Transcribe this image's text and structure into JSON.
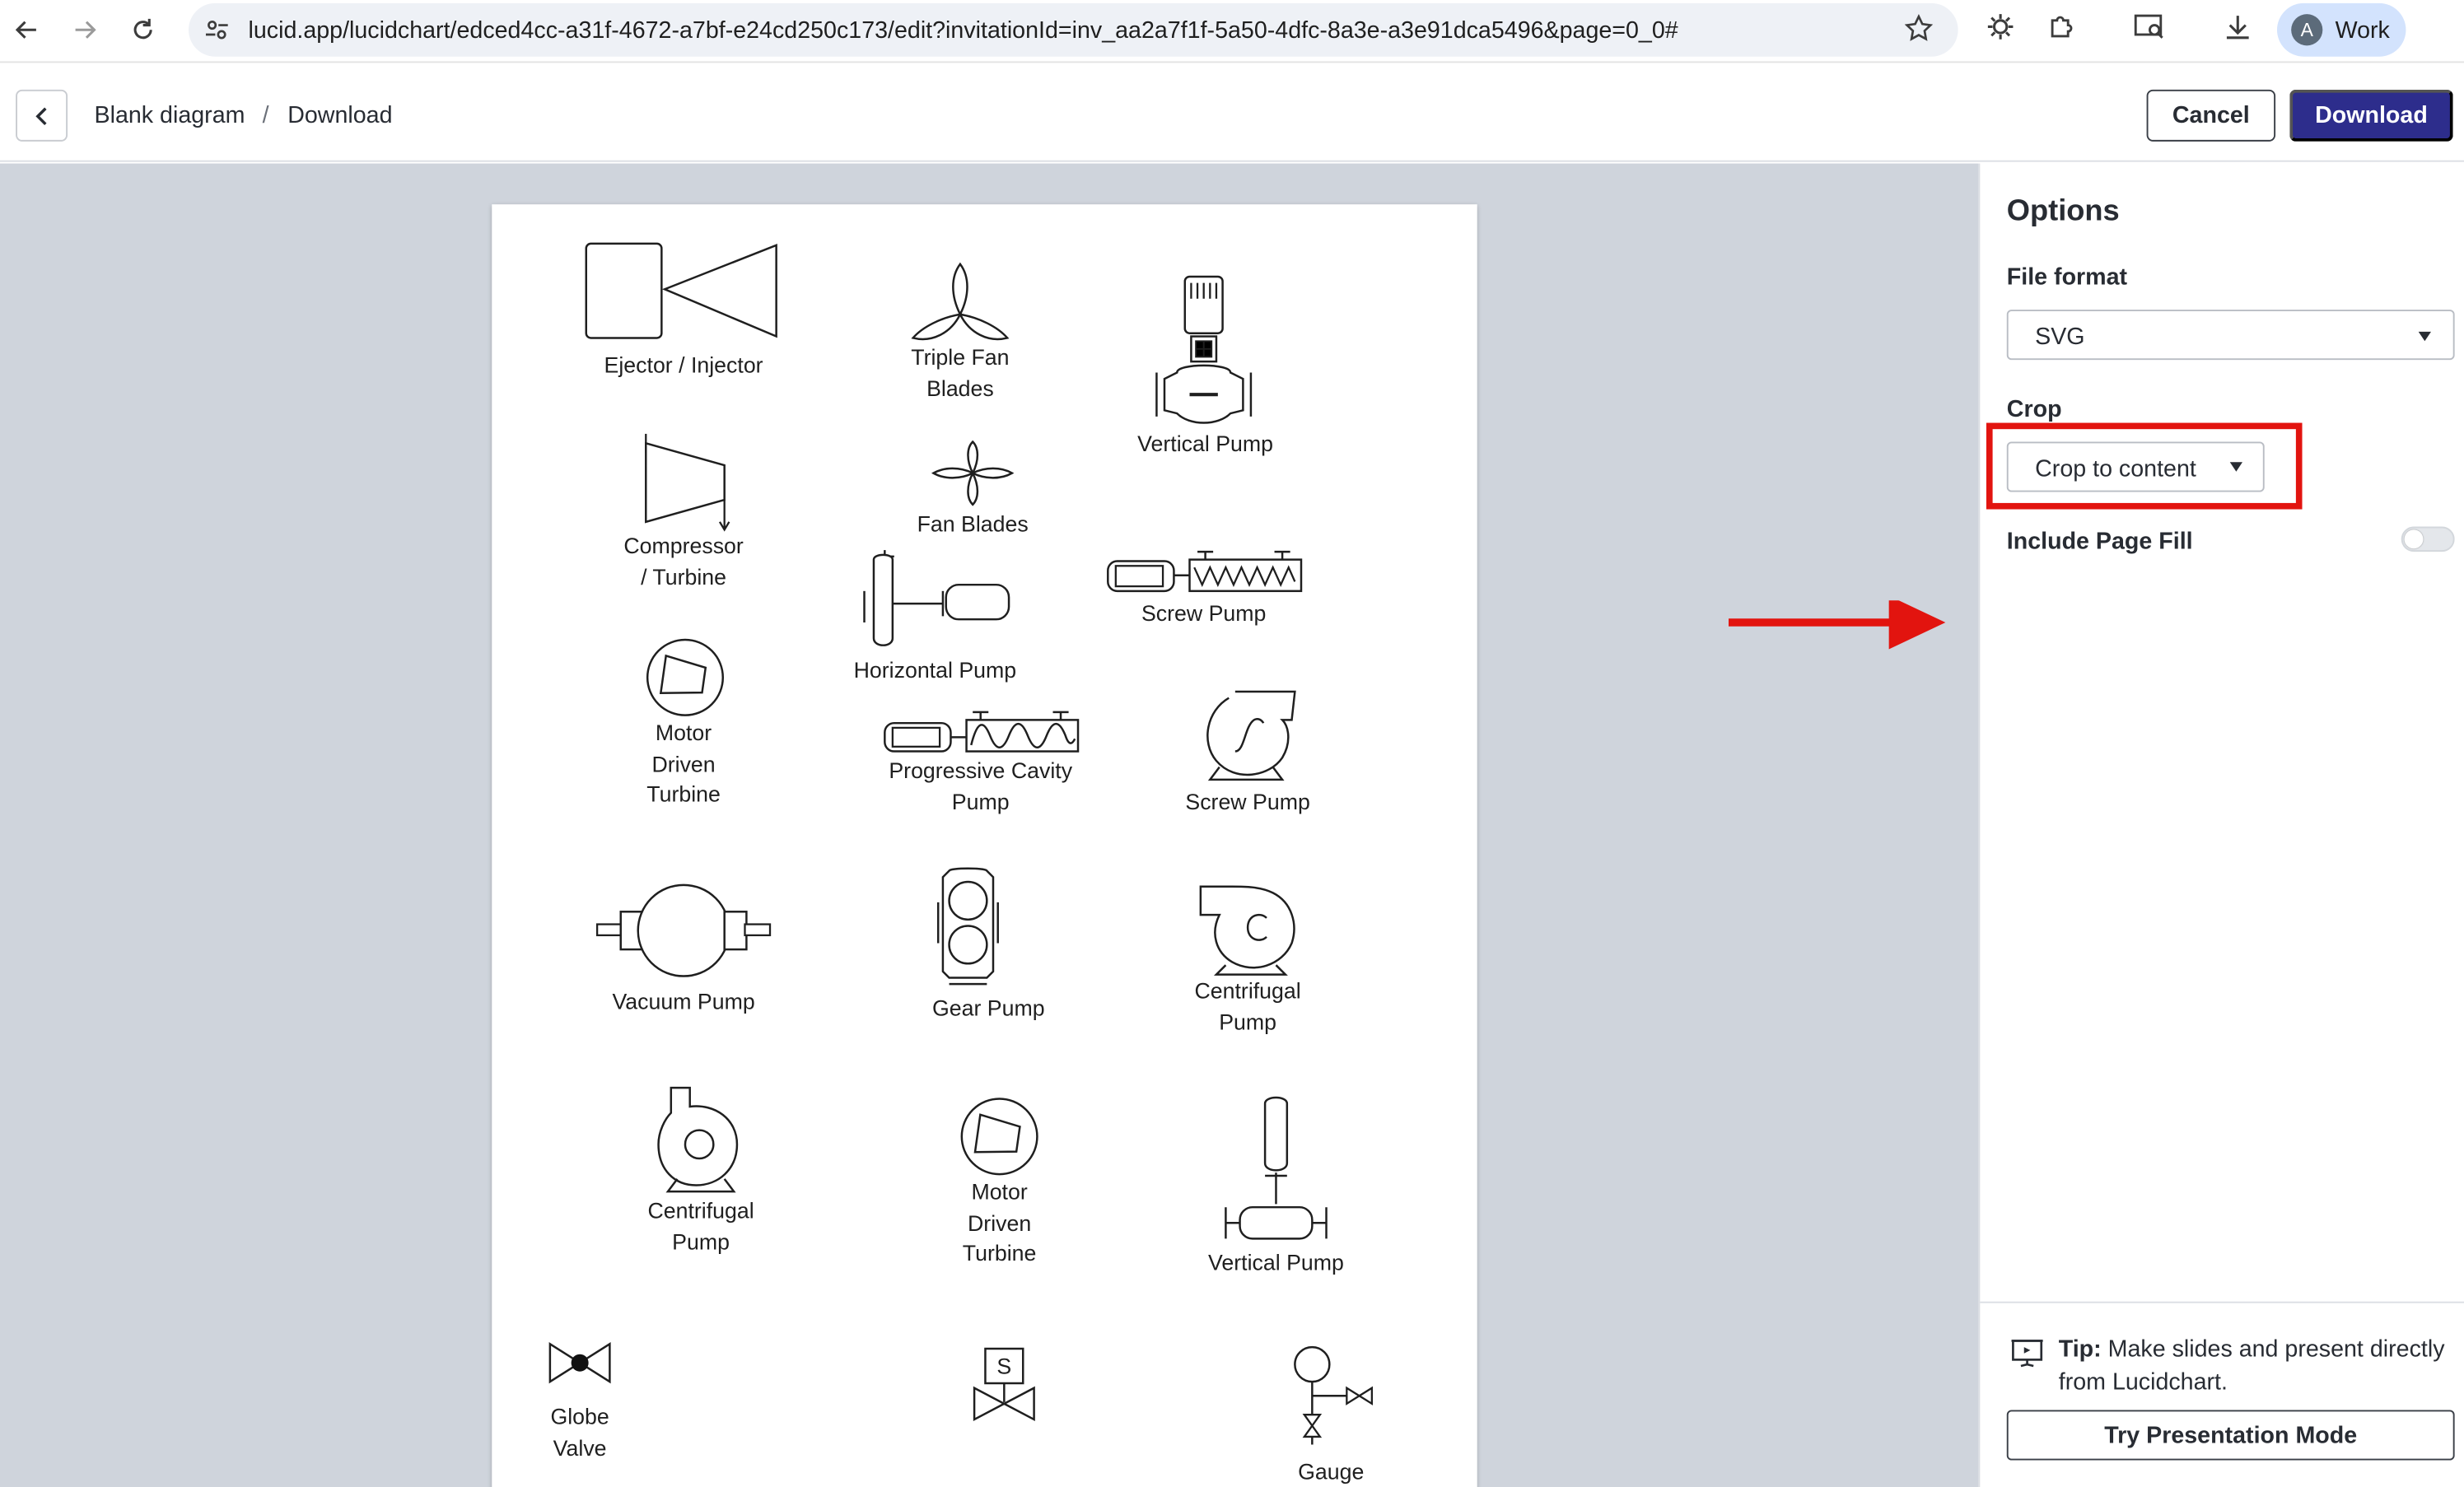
{
  "browser": {
    "url": "lucid.app/lucidchart/edced4cc-a31f-4672-a7bf-e24cd250c173/edit?invitationId=inv_aa2a7f1f-5a50-4dfc-8a3e-a3e91dca5496&page=0_0#",
    "profile_initial": "A",
    "profile_label": "Work"
  },
  "header": {
    "breadcrumb_doc": "Blank diagram",
    "breadcrumb_sep": "/",
    "breadcrumb_page": "Download",
    "cancel_label": "Cancel",
    "download_label": "Download"
  },
  "canvas": {
    "shapes": [
      {
        "id": "ejector-injector",
        "label": "Ejector / Injector"
      },
      {
        "id": "triple-fan-blades",
        "label": "Triple Fan\nBlades"
      },
      {
        "id": "vertical-pump-1",
        "label": "Vertical Pump"
      },
      {
        "id": "compressor-turbine",
        "label": "Compressor\n/ Turbine"
      },
      {
        "id": "fan-blades",
        "label": "Fan Blades"
      },
      {
        "id": "horizontal-pump",
        "label": "Horizontal Pump"
      },
      {
        "id": "screw-pump-1",
        "label": "Screw Pump"
      },
      {
        "id": "motor-driven-turbine-1",
        "label": "Motor\nDriven\nTurbine"
      },
      {
        "id": "progressive-cavity-pump",
        "label": "Progressive Cavity\nPump"
      },
      {
        "id": "screw-pump-2",
        "label": "Screw Pump"
      },
      {
        "id": "vacuum-pump",
        "label": "Vacuum Pump"
      },
      {
        "id": "gear-pump",
        "label": "Gear Pump"
      },
      {
        "id": "centrifugal-pump-1",
        "label": "Centrifugal\nPump"
      },
      {
        "id": "centrifugal-pump-2",
        "label": "Centrifugal\nPump"
      },
      {
        "id": "motor-driven-turbine-2",
        "label": "Motor\nDriven\nTurbine"
      },
      {
        "id": "vertical-pump-2",
        "label": "Vertical Pump"
      },
      {
        "id": "globe-valve",
        "label": "Globe\nValve"
      },
      {
        "id": "solenoid-valve-letter",
        "label": "S"
      },
      {
        "id": "gauge",
        "label": "Gauge"
      }
    ]
  },
  "options": {
    "title": "Options",
    "file_format_label": "File format",
    "file_format_value": "SVG",
    "crop_label": "Crop",
    "crop_value": "Crop to content",
    "include_page_fill_label": "Include Page Fill",
    "include_page_fill_on": false,
    "tip_bold": "Tip:",
    "tip_text": " Make slides and present directly from Lucidchart.",
    "try_button_label": "Try Presentation Mode"
  },
  "colors": {
    "primary_button": "#2d2d8c",
    "annotation_red": "#e2140f",
    "canvas_bg": "#cfd4dc"
  }
}
